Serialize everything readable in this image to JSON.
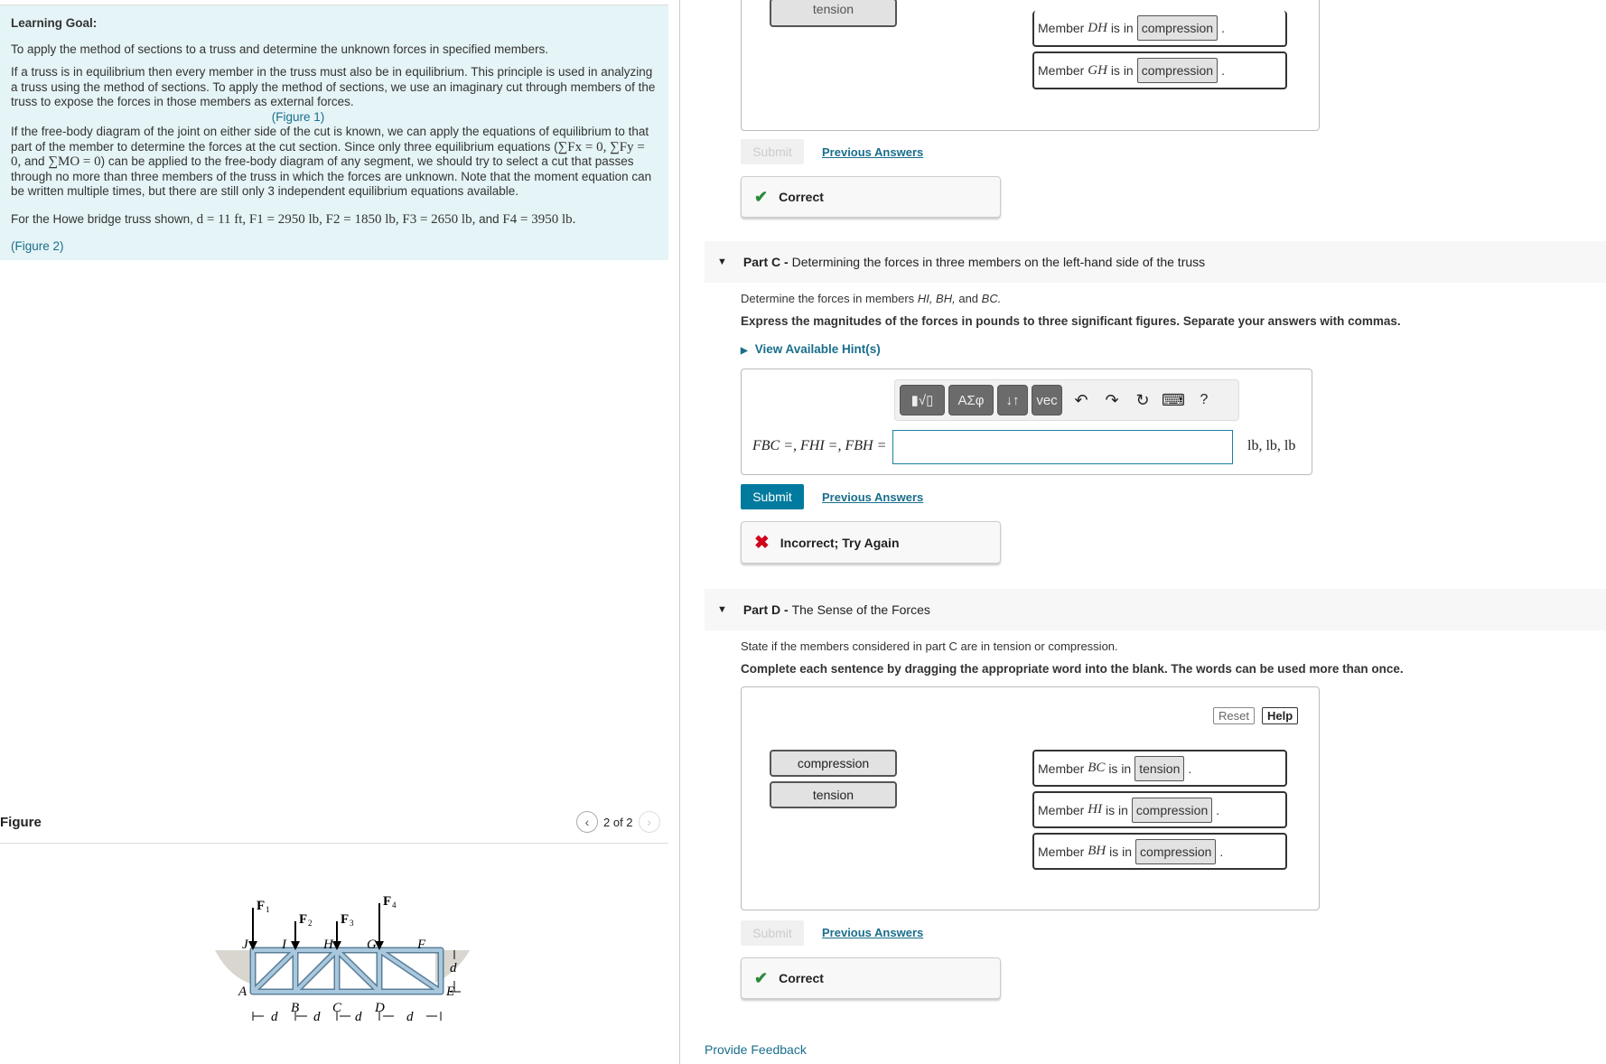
{
  "learning_goal": {
    "heading": "Learning Goal:",
    "p1": "To apply the method of sections to a truss and determine the unknown forces in specified members.",
    "p2": "If a truss is in equilibrium then every member in the truss must also be in equilibrium. This principle is used in analyzing a truss using the method of sections. To apply the method of sections, we use an imaginary cut through members of the truss to expose the forces in those members as external forces.",
    "figure1_link": "(Figure 1)",
    "p3a": "If the free-body diagram of the joint on either side of the cut is known, we can apply the equations of equilibrium to that part of the member to determine the forces at the cut section. Since only three equilibrium equations (",
    "eq1": "∑Fx = 0, ∑Fy = 0,",
    "p3b": "and",
    "eq2": "∑MO = 0",
    "p3c": ") can be applied to the free-body diagram of any segment, we should try to select a cut that passes through no more than three members of the truss in which the forces are unknown. Note that the moment equation can be written multiple times, but there are still only 3 independent equilibrium equations available.",
    "p4a": "For the Howe bridge truss shown,",
    "p4_values": "d = 11 ft, F1 = 2950 lb, F2 = 1850 lb, F3 = 2650 lb,",
    "p4b": "and",
    "p4_last": "F4 = 3950 lb.",
    "figure2_link": "(Figure 2)"
  },
  "figure": {
    "title": "Figure",
    "pager": "2 of 2",
    "prev_icon": "chevron-left-icon",
    "next_icon": "chevron-right-icon",
    "labels": {
      "F1": "F",
      "F2": "F",
      "F3": "F",
      "F4": "F",
      "s1": "1",
      "s2": "2",
      "s3": "3",
      "s4": "4",
      "J": "J",
      "I": "I",
      "H": "H",
      "G": "G",
      "F": "F",
      "A": "A",
      "B": "B",
      "C": "C",
      "D": "D",
      "E": "E",
      "d": "d"
    }
  },
  "part_b": {
    "tile_tension": "tension",
    "sentences": [
      {
        "pre": "Member",
        "member": "DH",
        "mid": "is in",
        "answer": "compression",
        "post": "."
      },
      {
        "pre": "Member",
        "member": "GH",
        "mid": "is in",
        "answer": "compression",
        "post": "."
      }
    ],
    "submit": "Submit",
    "previous_answers": "Previous Answers",
    "feedback": "Correct"
  },
  "part_c": {
    "label": "Part C -",
    "title": "Determining the forces in three members on the left-hand side of the truss",
    "instruction_a": "Determine the forces in members",
    "instruction_members": "HI, BH,",
    "instruction_and": "and",
    "instruction_last": "BC.",
    "express": "Express the magnitudes of the forces in pounds to three significant figures. Separate your answers with commas.",
    "hint": "View Available Hint(s)",
    "toolbar": {
      "templates": "▮√▯",
      "greek": "ΑΣφ",
      "arrows": "↓↑",
      "vec": "vec",
      "undo": "↶",
      "redo": "↷",
      "reset": "↻",
      "keyboard": "⌨",
      "help": "?"
    },
    "answer_label": "FBC =, FHI =, FBH =",
    "answer_value": "",
    "units": "lb, lb, lb",
    "submit": "Submit",
    "previous_answers": "Previous Answers",
    "feedback": "Incorrect; Try Again"
  },
  "part_d": {
    "label": "Part D -",
    "title": "The Sense of the Forces",
    "instruction": "State if the members considered in part C are in tension or compression.",
    "directions": "Complete each sentence by dragging the appropriate word into the blank. The words can be used more than once.",
    "reset": "Reset",
    "help": "Help",
    "tiles": [
      "compression",
      "tension"
    ],
    "sentences": [
      {
        "pre": "Member",
        "member": "BC",
        "mid": "is in",
        "answer": "tension",
        "post": "."
      },
      {
        "pre": "Member",
        "member": "HI",
        "mid": "is in",
        "answer": "compression",
        "post": "."
      },
      {
        "pre": "Member",
        "member": "BH",
        "mid": "is in",
        "answer": "compression",
        "post": "."
      }
    ],
    "submit": "Submit",
    "previous_answers": "Previous Answers",
    "feedback": "Correct"
  },
  "provide_feedback": "Provide Feedback",
  "colors": {
    "goal_bg": "#e5f4f6",
    "accent": "#007a9e",
    "link": "#1a6e8c",
    "correct": "#2a8a3a",
    "incorrect": "#d0021b",
    "truss": "#8fb3cc"
  }
}
